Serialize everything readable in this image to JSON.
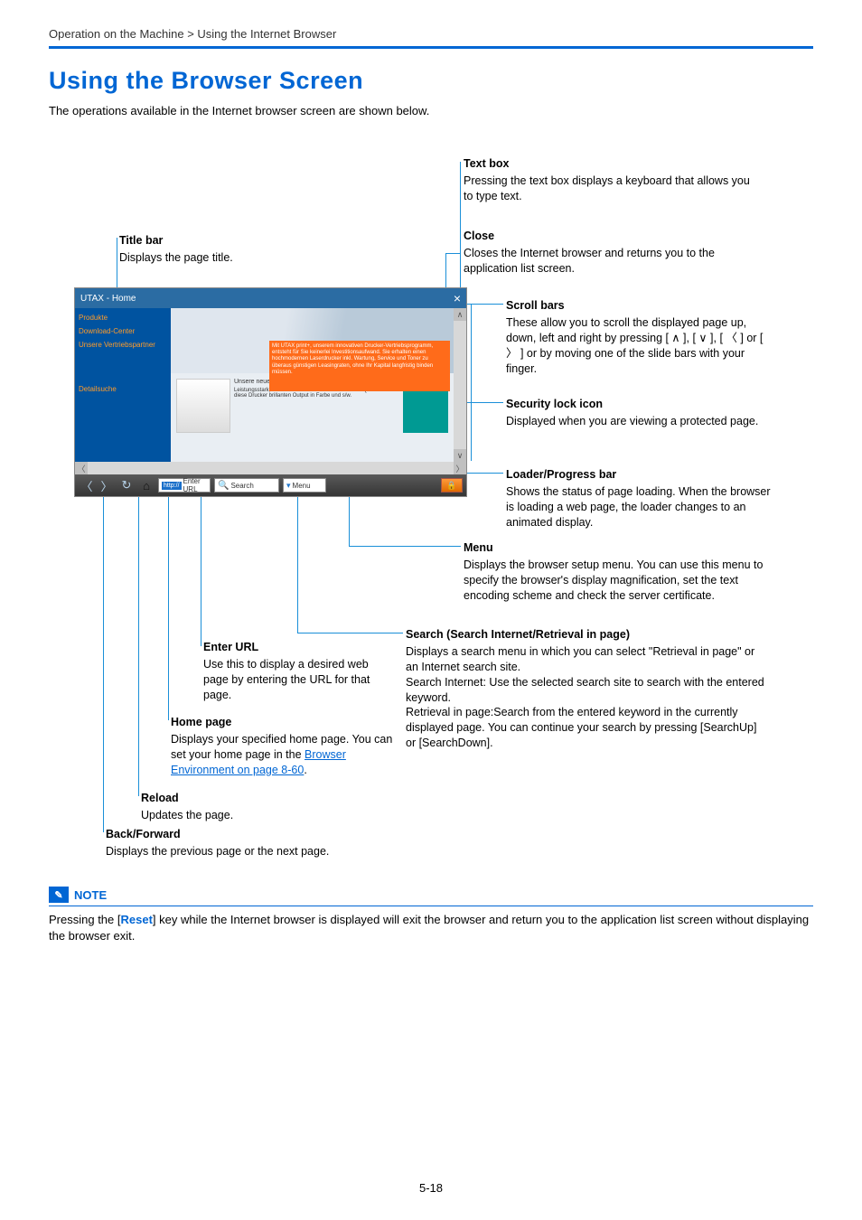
{
  "breadcrumb": "Operation on the Machine > Using the Internet Browser",
  "heading": "Using the Browser Screen",
  "intro": "The operations available in the Internet browser screen are shown below.",
  "labels": {
    "textbox": {
      "title": "Text box",
      "body": "Pressing the text box displays a keyboard that allows you to type text."
    },
    "titlebar": {
      "title": "Title bar",
      "body": "Displays the page title."
    },
    "close": {
      "title": "Close",
      "body": "Closes the Internet browser and returns you to the application list screen."
    },
    "scroll": {
      "title": "Scroll bars",
      "body": "These allow you to scroll the displayed page up, down, left and right by pressing [ ∧ ], [ ∨ ], [ 〈 ] or [ 〉 ] or by moving one of the slide bars with your finger."
    },
    "security": {
      "title": "Security lock icon",
      "body": "Displayed when you are viewing a protected page."
    },
    "loader": {
      "title": "Loader/Progress bar",
      "body": "Shows the status of page loading. When the browser is loading a web page, the loader changes to an animated display."
    },
    "menu": {
      "title": "Menu",
      "body": "Displays the browser setup menu. You can use this menu to specify the browser's display magnification, set the text encoding scheme and check the server certificate."
    },
    "search": {
      "title": "Search (Search Internet/Retrieval in page)",
      "body": "Displays a search menu in which you can select \"Retrieval in page\" or an Internet search site.\nSearch Internet: Use the selected search site to search with the entered keyword.\nRetrieval in page:Search from the entered keyword in the currently displayed page. You can continue your search by pressing [SearchUp] or [SearchDown]."
    },
    "enterurl": {
      "title": "Enter URL",
      "body": "Use this to display a desired web page by entering the URL for that page."
    },
    "home": {
      "title": "Home page",
      "body_a": "Displays your specified home page. You can set your home page in the ",
      "link": "Browser Environment on page 8-60",
      "body_b": "."
    },
    "reload": {
      "title": "Reload",
      "body": "Updates the page."
    },
    "backforward": {
      "title": "Back/Forward",
      "body": "Displays the previous page or the next page."
    }
  },
  "browser": {
    "title": "UTAX - Home",
    "sidebar": [
      "Produkte",
      "Download-Center",
      "Unsere Vertriebspartner",
      "Detailsuche"
    ],
    "orange": "Mit UTAX print+, unserem innovativen Drucker-Vertriebsprogramm, entsteht für Sie keinerlei Investitionsaufwand. Sie erhalten einen hochmodernen Laserdrucker inkl. Wartung, Service und Toner zu überaus günstigen Leasingraten, ohne Ihr Kapital langfristig binden müssen.",
    "col_title": "Unsere neuen Farbdrucksysteme CLP 3521/3621/3626",
    "col_body": "Leistungsstark, schnell und mit absolut bestechender Qualität liefern diese Drucker brillanten Output in Farbe und s/w.",
    "toolbar": {
      "enter_url": "Enter URL",
      "search": "Search",
      "menu": "Menu"
    }
  },
  "note": {
    "title": "NOTE",
    "body_a": "Pressing the [",
    "reset": "Reset",
    "body_b": "] key while the Internet browser is displayed will exit the browser and return you to the application list screen without displaying the browser exit."
  },
  "page_number": "5-18"
}
